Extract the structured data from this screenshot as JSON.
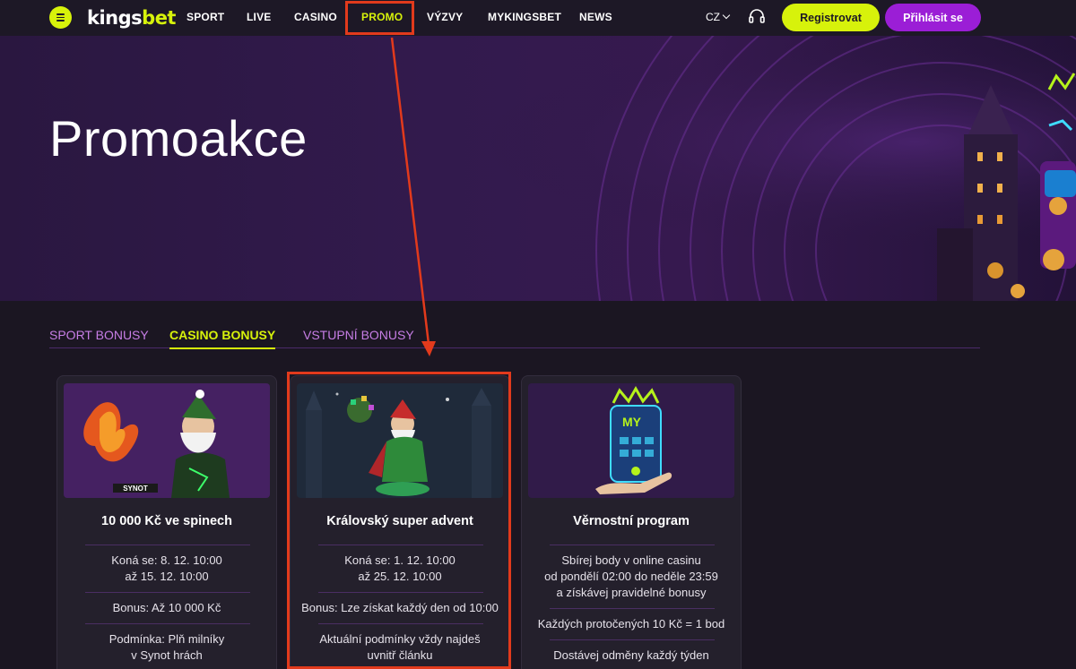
{
  "nav": {
    "logo_part1": "kings",
    "logo_part2": "bet",
    "items": [
      {
        "label": "SPORT"
      },
      {
        "label": "LIVE"
      },
      {
        "label": "CASINO"
      },
      {
        "label": "PROMO"
      },
      {
        "label": "VÝZVY"
      },
      {
        "label": "MYKINGSBET"
      },
      {
        "label": "NEWS"
      }
    ],
    "language": "CZ",
    "register_label": "Registrovat",
    "login_label": "Přihlásit se"
  },
  "hero": {
    "title": "Promoakce"
  },
  "tabs": [
    {
      "label": "SPORT BONUSY"
    },
    {
      "label": "CASINO BONUSY"
    },
    {
      "label": "VSTUPNÍ BONUSY"
    }
  ],
  "cards": [
    {
      "title": "10 000 Kč ve spinech",
      "date_line1": "Koná se: 8. 12. 10:00",
      "date_line2": "až 15. 12. 10:00",
      "bonus": "Bonus: Až 10 000 Kč",
      "condition_line1": "Podmínka: Plň milníky",
      "condition_line2": "v Synot hrách",
      "badge": "SYNOT"
    },
    {
      "title": "Královský super advent",
      "date_line1": "Koná se: 1. 12. 10:00",
      "date_line2": "až 25. 12. 10:00",
      "bonus": "Bonus: Lze získat každý den od 10:00",
      "condition_line1": "Aktuální podmínky vždy najdeš",
      "condition_line2": "uvnitř článku"
    },
    {
      "title": "Věrnostní program",
      "desc_line1": "Sbírej body v online casinu",
      "desc_line2": "od pondělí 02:00 do neděle 23:59",
      "desc_line3": "a získávej pravidelné bonusy",
      "points": "Každých protočených 10 Kč = 1 bod",
      "reward": "Dostávej odměny každý týden",
      "badge": "MY"
    }
  ],
  "colors": {
    "accent": "#d7f20b",
    "purple": "#9b1ed6",
    "annotation_red": "#e23a1c",
    "tab_inactive": "#c77ee6"
  }
}
